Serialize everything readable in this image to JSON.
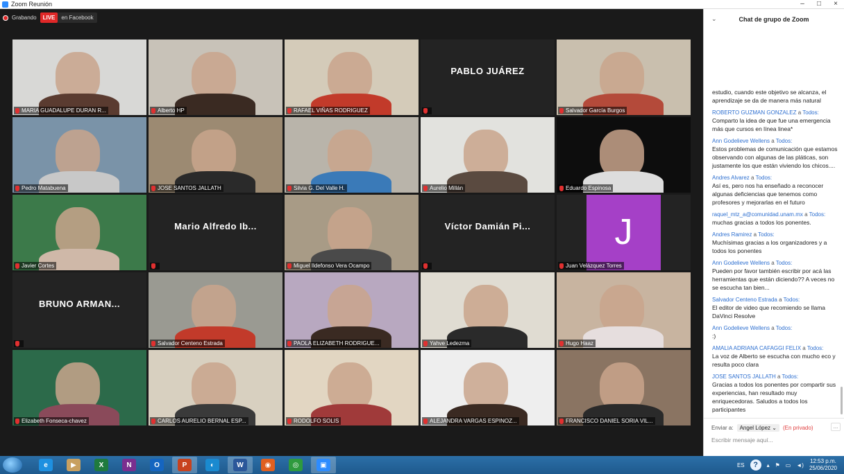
{
  "window": {
    "title": "Zoom Reunión"
  },
  "status": {
    "recording_label": "Grabando",
    "live_badge": "LIVE",
    "live_target": "en Facebook"
  },
  "tiles": [
    {
      "name": "MARIA GUADALUPE DURAN R...",
      "type": "video",
      "bg": "#d8d8d6",
      "fg": "#5a3b30"
    },
    {
      "name": "Alberto HP",
      "type": "video",
      "bg": "#c8c2b8",
      "fg": "#3a2a22"
    },
    {
      "name": "RAFAEL VIÑAS RODRIGUEZ",
      "type": "video",
      "bg": "#d4cbb9",
      "fg": "#c23a2a"
    },
    {
      "name": "PABLO JUÁREZ",
      "type": "name_only"
    },
    {
      "name": "Salvador García Burgos",
      "type": "video",
      "bg": "#c9bfae",
      "fg": "#b44a3a"
    },
    {
      "name": "Pedro Matabuena",
      "type": "video",
      "bg": "#7a93a8",
      "fg": "#c8c8c8"
    },
    {
      "name": "JOSE SANTOS JALLATH",
      "type": "video",
      "bg": "#9c8a72",
      "fg": "#2a2a2a"
    },
    {
      "name": "Silvia G. Del Valle H.",
      "type": "video",
      "bg": "#b9b4aa",
      "fg": "#3a7ab8"
    },
    {
      "name": "Aurelio Millán",
      "type": "video",
      "bg": "#e2e2de",
      "fg": "#5a4a40"
    },
    {
      "name": "Eduardo Espinosa",
      "type": "video",
      "bg": "#0d0d0d",
      "fg": "#dddddd"
    },
    {
      "name": "Javier Cortes",
      "type": "video",
      "active": true,
      "bg": "#3c7a4a",
      "fg": "#cfb8a8"
    },
    {
      "name": "Mario Alfredo Ib...",
      "type": "name_only"
    },
    {
      "name": "Miguel Ildefonso Vera Ocampo",
      "type": "video",
      "bg": "#a89b86",
      "fg": "#4a4a4a"
    },
    {
      "name": "Víctor Damián Pi...",
      "type": "name_only"
    },
    {
      "name": "Juan Velázquez Torres",
      "type": "avatar",
      "initial": "J"
    },
    {
      "name": "BRUNO ARMAN...",
      "type": "name_only"
    },
    {
      "name": "Salvador Centeno Estrada",
      "type": "video",
      "bg": "#9a9a92",
      "fg": "#c23a2a"
    },
    {
      "name": "PAOLA ELIZABETH RODRIGUE...",
      "type": "video",
      "bg": "#b8a8c0",
      "fg": "#3a2a22"
    },
    {
      "name": "Yahve Ledezma",
      "type": "video",
      "bg": "#e0dcd2",
      "fg": "#2a2a2a"
    },
    {
      "name": "Hugo Haaz",
      "type": "video",
      "bg": "#c8b4a0",
      "fg": "#e6dede"
    },
    {
      "name": "Elizabeth Fonseca-chavez",
      "type": "video",
      "bg": "#2c6a4a",
      "fg": "#8a4a5a"
    },
    {
      "name": "CARLOS AURELIO BERNAL ESP...",
      "type": "video",
      "bg": "#d8d0c0",
      "fg": "#3a3a3a"
    },
    {
      "name": "RODOLFO SOLIS",
      "type": "video",
      "bg": "#e2d6c2",
      "fg": "#a03a3a"
    },
    {
      "name": "ALEJANDRA VARGAS ESPINOZ...",
      "type": "video",
      "bg": "#eeeeee",
      "fg": "#3a2a22"
    },
    {
      "name": "FRANCISCO DANIEL SORIA VIL...",
      "type": "video",
      "bg": "#8a7462",
      "fg": "#2a2a2a"
    }
  ],
  "chat": {
    "title": "Chat de grupo de Zoom",
    "to_word": "a",
    "messages": [
      {
        "sender": "",
        "recipient": "",
        "text": "estudio, cuando este objetivo se alcanza, el aprendizaje se da de manera más natural"
      },
      {
        "sender": "ROBERTO GUZMAN GONZALEZ",
        "recipient": "Todos:",
        "text": "Comparto la idea de que fue una emergencia más que cursos en línea linea*"
      },
      {
        "sender": "Ann Godelieve Wellens",
        "recipient": "Todos:",
        "text": "Estos problemas de comunicación que estamos observando con algunas de las pláticas, son justamente los que están viviendo los chicos...."
      },
      {
        "sender": "Andres Alvarez",
        "recipient": "Todos:",
        "text": "Así es, pero nos ha enseñado a reconocer algunas deficiencias que tenemos como profesores y mejorarlas en el futuro"
      },
      {
        "sender": "raquel_mtz_a@comunidad.unam.mx",
        "recipient": "Todos:",
        "text": "muchas gracias a todos los ponentes."
      },
      {
        "sender": "Andres Ramirez",
        "recipient": "Todos:",
        "text": "Muchísimas gracias a los organizadores y a todos los ponentes"
      },
      {
        "sender": "Ann Godelieve Wellens",
        "recipient": "Todos:",
        "text": "Pueden por favor también escribir por acá las herramientas que están diciendo?? A veces no se escucha tan bien..."
      },
      {
        "sender": "Salvador Centeno Estrada",
        "recipient": "Todos:",
        "text": "El editor de video que recomiendo se llama DaVinci Resolve"
      },
      {
        "sender": "Ann Godelieve Wellens",
        "recipient": "Todos:",
        "text": ":)"
      },
      {
        "sender": "AMALIA ADRIANA CAFAGGI FELIX",
        "recipient": "Todos:",
        "text": "La voz de Alberto se escucha con mucho eco y resulta poco clara"
      },
      {
        "sender": "JOSE SANTOS JALLATH",
        "recipient": "Todos:",
        "text": "Gracias a todos los ponentes por compartir sus experiencias, han resultado muy enriquecedoras. Saludos a todos los participantes"
      }
    ],
    "send_to_label": "Enviar a:",
    "recipient_selected": "Angel López",
    "private_label": "(En privado)",
    "more_label": "...",
    "input_placeholder": "Escribir mensaje aquí..."
  },
  "taskbar": {
    "apps": [
      {
        "label": "e",
        "color": "#1e90e0"
      },
      {
        "label": "▶",
        "color": "#c8a060"
      },
      {
        "label": "X",
        "color": "#1f7a3e"
      },
      {
        "label": "N",
        "color": "#7a2f8f"
      },
      {
        "label": "O",
        "color": "#1565c0"
      },
      {
        "label": "P",
        "color": "#c8421e",
        "active": true
      },
      {
        "label": "◐",
        "color": "#1a8ad0"
      },
      {
        "label": "W",
        "color": "#2b579a",
        "active": true
      },
      {
        "label": "◉",
        "color": "#e06020"
      },
      {
        "label": "◎",
        "color": "#2e9a3e"
      },
      {
        "label": "▣",
        "color": "#2d8cff",
        "active": true
      }
    ],
    "language": "ES",
    "help": "?",
    "time": "12:53 p.m.",
    "date": "25/06/2020"
  }
}
